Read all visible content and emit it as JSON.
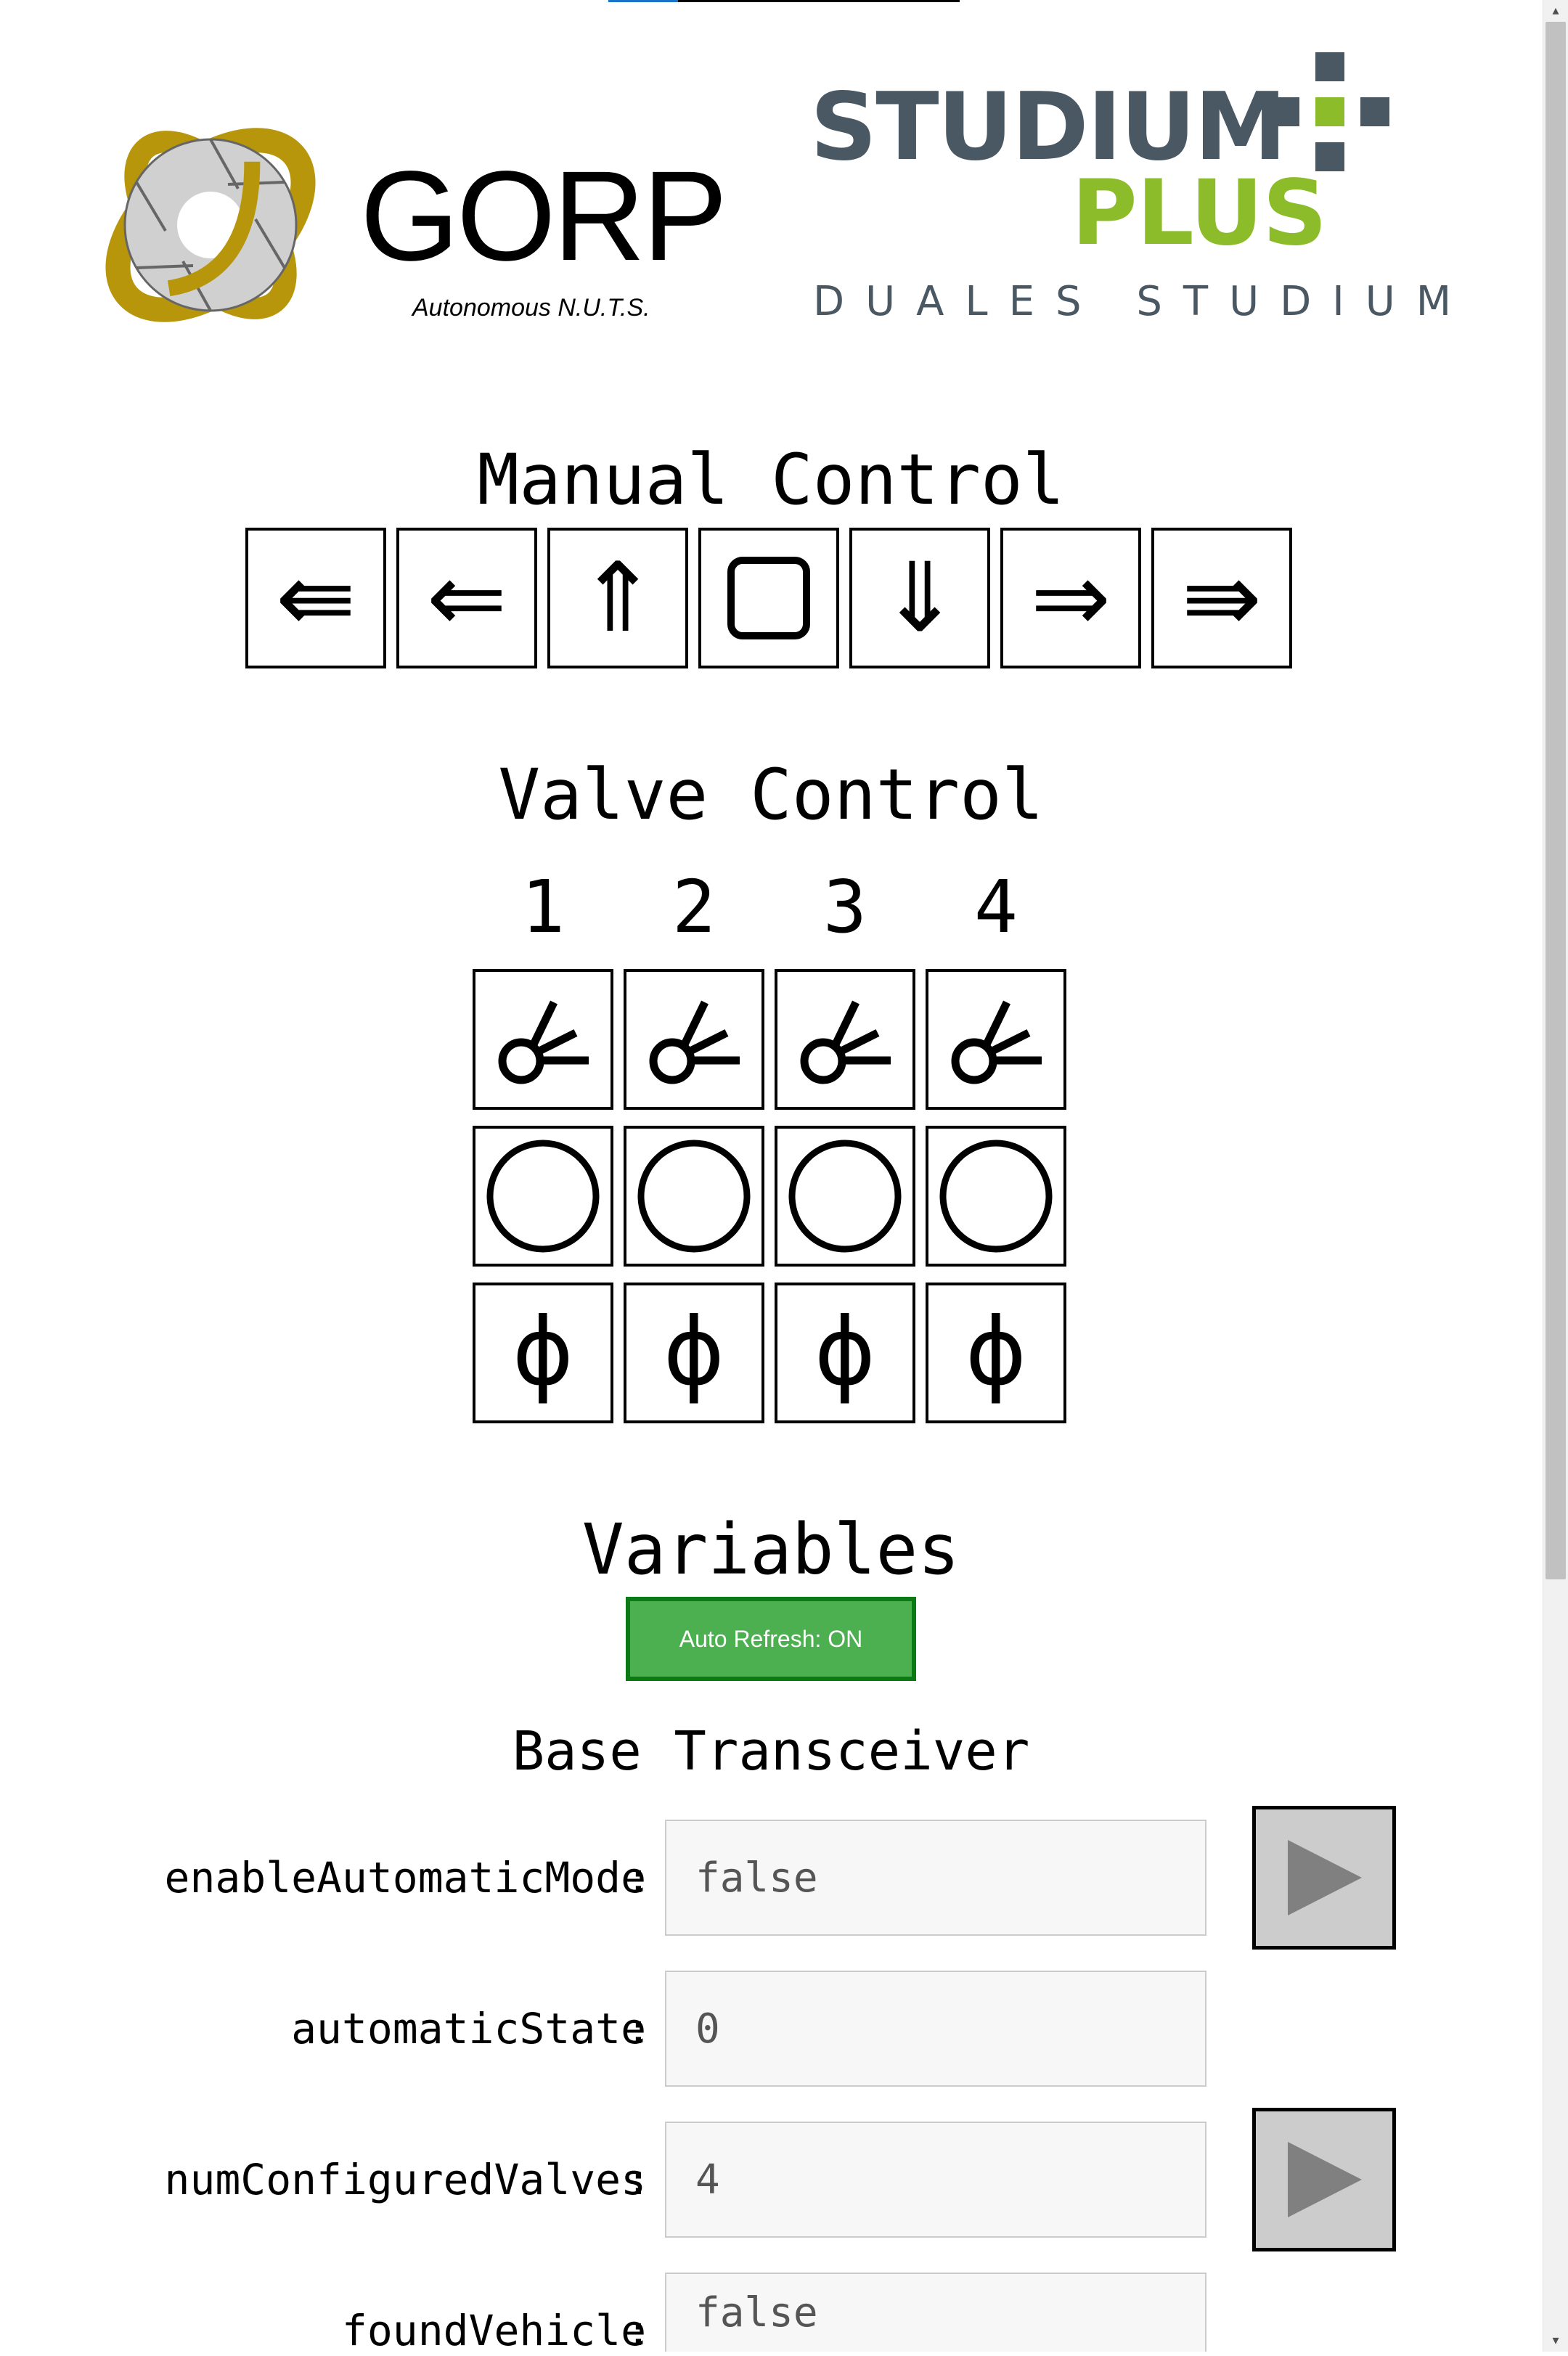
{
  "logos": {
    "gorp": {
      "title": "GORP",
      "subtitle": "Autonomous N.U.T.S."
    },
    "studium_plus": {
      "line1": "STUDIUM",
      "line2": "PLUS",
      "line3": "DUALES STUDIUM"
    }
  },
  "manual_control": {
    "title": "Manual Control",
    "buttons": [
      {
        "name": "fast-left",
        "glyph": "⇚"
      },
      {
        "name": "left",
        "glyph": "⇐"
      },
      {
        "name": "forward",
        "glyph": "⇑"
      },
      {
        "name": "stop",
        "glyph": "□"
      },
      {
        "name": "backward",
        "glyph": "⇓"
      },
      {
        "name": "right",
        "glyph": "⇒"
      },
      {
        "name": "fast-right",
        "glyph": "⇛"
      }
    ]
  },
  "valve_control": {
    "title": "Valve Control",
    "valves": [
      "1",
      "2",
      "3",
      "4"
    ],
    "rows": [
      {
        "name": "spray",
        "icon": "sprinkler-icon"
      },
      {
        "name": "open-close",
        "icon": "circle-icon"
      },
      {
        "name": "toggle",
        "icon": "phi-icon",
        "glyph": "ϕ"
      }
    ]
  },
  "variables": {
    "title": "Variables",
    "auto_refresh_label": "Auto Refresh: ON",
    "auto_refresh_color": "#4caf50",
    "section_title": "Base Transceiver",
    "items": [
      {
        "label": "enableAutomaticMode",
        "separator": ":",
        "value": "false",
        "has_action": true
      },
      {
        "label": "automaticState",
        "separator": ":",
        "value": "0",
        "has_action": false
      },
      {
        "label": "numConfiguredValves",
        "separator": ":",
        "value": "4",
        "has_action": true
      },
      {
        "label": "foundVehicle",
        "separator": ":",
        "value": "false",
        "has_action": false
      }
    ]
  },
  "colors": {
    "gorp_gold": "#b8960c",
    "studium_gray": "#4a5863",
    "plus_green": "#8dbc2b",
    "play_button_bg": "#cccccc"
  }
}
